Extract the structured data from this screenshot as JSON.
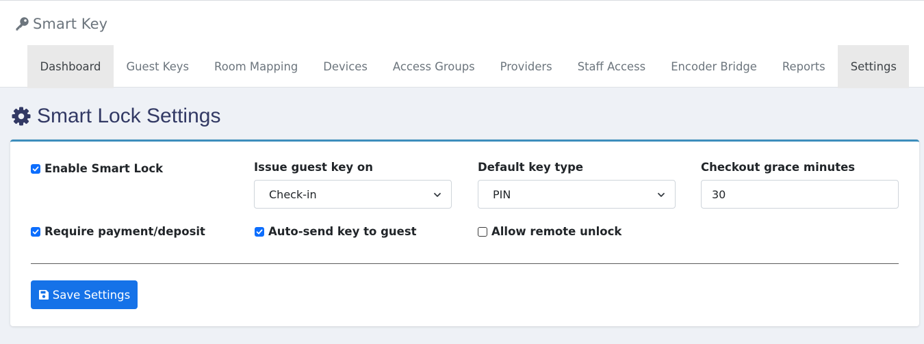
{
  "app": {
    "brand": "Smart Key"
  },
  "nav": {
    "tabs": [
      {
        "label": "Dashboard",
        "active": true
      },
      {
        "label": "Guest Keys",
        "active": false
      },
      {
        "label": "Room Mapping",
        "active": false
      },
      {
        "label": "Devices",
        "active": false
      },
      {
        "label": "Access Groups",
        "active": false
      },
      {
        "label": "Providers",
        "active": false
      },
      {
        "label": "Staff Access",
        "active": false
      },
      {
        "label": "Encoder Bridge",
        "active": false
      },
      {
        "label": "Reports",
        "active": false
      },
      {
        "label": "Settings",
        "active": true
      }
    ]
  },
  "page": {
    "title": "Smart Lock Settings"
  },
  "settings": {
    "enable_smart_lock": {
      "label": "Enable Smart Lock",
      "checked": true
    },
    "issue_guest_key_on": {
      "label": "Issue guest key on",
      "value": "Check-in"
    },
    "default_key_type": {
      "label": "Default key type",
      "value": "PIN"
    },
    "checkout_grace_minutes": {
      "label": "Checkout grace minutes",
      "value": "30"
    },
    "require_payment": {
      "label": "Require payment/deposit",
      "checked": true
    },
    "auto_send_key": {
      "label": "Auto-send key to guest",
      "checked": true
    },
    "allow_remote_unlock": {
      "label": "Allow remote unlock",
      "checked": false
    }
  },
  "actions": {
    "save_label": "Save Settings"
  },
  "colors": {
    "primary": "#0d6efd",
    "card_accent": "#3c8dbc",
    "title": "#323964",
    "background": "#eef1f6"
  },
  "icons": {
    "brand": "key-icon",
    "title": "gear-icon",
    "save": "floppy-disk-icon"
  }
}
